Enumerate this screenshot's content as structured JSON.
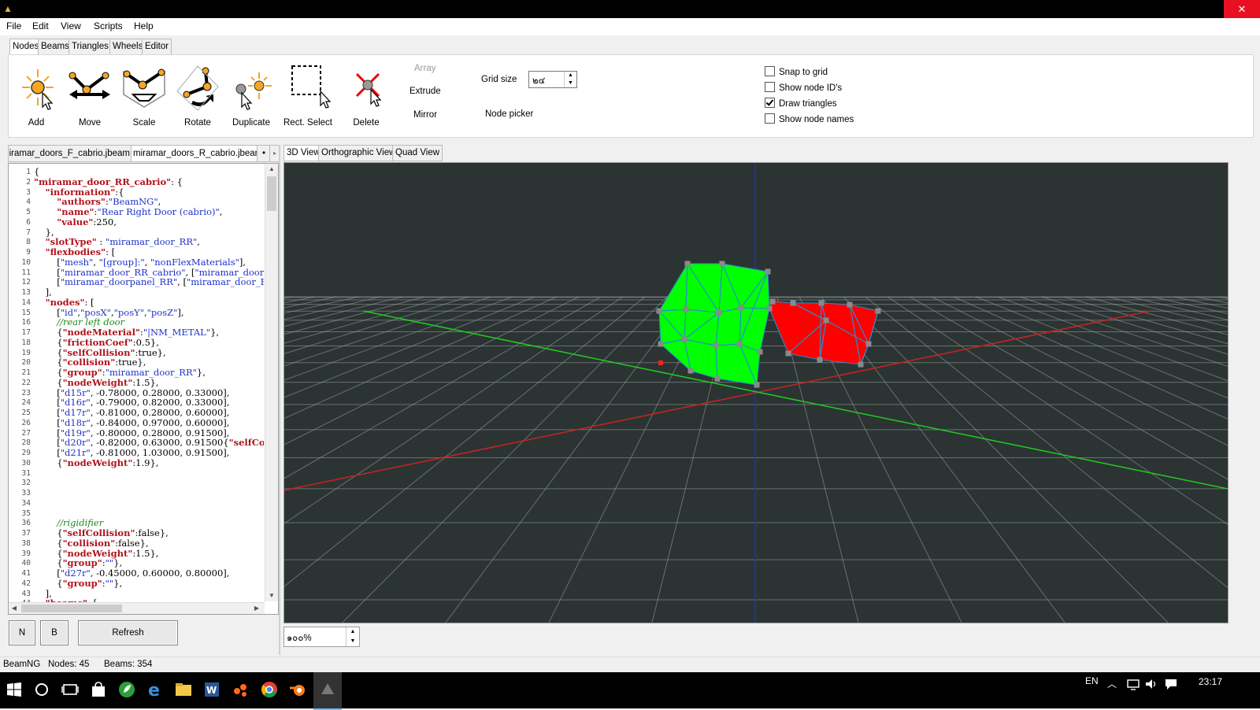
{
  "menu": [
    "File",
    "Edit",
    "View",
    "Scripts",
    "Help"
  ],
  "ribbon": {
    "tabs": [
      "Nodes",
      "Beams",
      "Triangles",
      "Wheels",
      "Editor"
    ],
    "tools": {
      "add": "Add",
      "move": "Move",
      "scale": "Scale",
      "rotate": "Rotate",
      "duplicate": "Duplicate",
      "rect_select": "Rect. Select",
      "delete": "Delete"
    },
    "array": "Array",
    "extrude": "Extrude",
    "mirror": "Mirror",
    "grid_size_label": "Grid size",
    "grid_size_value": "๒๔",
    "node_picker": "Node picker",
    "checkboxes": [
      {
        "label": "Snap to grid",
        "checked": false
      },
      {
        "label": "Show node ID's",
        "checked": false
      },
      {
        "label": "Draw triangles",
        "checked": true
      },
      {
        "label": "Show node names",
        "checked": false
      }
    ]
  },
  "file_tabs": [
    "miramar_doors_F_cabrio.jbeam",
    "miramar_doors_R_cabrio.jbeam"
  ],
  "file_tab_more": "•",
  "file_tab_arrow": "▸",
  "editor": {
    "lines": [
      [
        [
          "p",
          "{"
        ]
      ],
      [
        [
          "k",
          "\"miramar_door_RR_cabrio\""
        ],
        [
          "p",
          ": {"
        ]
      ],
      [
        [
          "p",
          "    "
        ],
        [
          "k",
          "\"information\""
        ],
        [
          "p",
          ":{"
        ]
      ],
      [
        [
          "p",
          "        "
        ],
        [
          "k",
          "\"authors\""
        ],
        [
          "p",
          ":"
        ],
        [
          "s",
          "\"BeamNG\""
        ],
        [
          "p",
          ","
        ]
      ],
      [
        [
          "p",
          "        "
        ],
        [
          "k",
          "\"name\""
        ],
        [
          "p",
          ":"
        ],
        [
          "s",
          "\"Rear Right Door (cabrio)\""
        ],
        [
          "p",
          ","
        ]
      ],
      [
        [
          "p",
          "        "
        ],
        [
          "k",
          "\"value\""
        ],
        [
          "p",
          ":250,"
        ]
      ],
      [
        [
          "p",
          "    },"
        ]
      ],
      [
        [
          "p",
          "    "
        ],
        [
          "k",
          "\"slotType\""
        ],
        [
          "p",
          " : "
        ],
        [
          "s",
          "\"miramar_door_RR\""
        ],
        [
          "p",
          ","
        ]
      ],
      [
        [
          "p",
          "    "
        ],
        [
          "k",
          "\"flexbodies\""
        ],
        [
          "p",
          ": ["
        ]
      ],
      [
        [
          "p",
          "        ["
        ],
        [
          "s",
          "\"mesh\""
        ],
        [
          "p",
          ", "
        ],
        [
          "s",
          "\"[group]:\""
        ],
        [
          "p",
          ", "
        ],
        [
          "s",
          "\"nonFlexMaterials\""
        ],
        [
          "p",
          "],"
        ]
      ],
      [
        [
          "p",
          "        ["
        ],
        [
          "s",
          "\"miramar_door_RR_cabrio\""
        ],
        [
          "p",
          ", ["
        ],
        [
          "s",
          "\"miramar_door"
        ]
      ],
      [
        [
          "p",
          "        ["
        ],
        [
          "s",
          "\"miramar_doorpanel_RR\""
        ],
        [
          "p",
          ", ["
        ],
        [
          "s",
          "\"miramar_door_F"
        ]
      ],
      [
        [
          "p",
          "    ],"
        ]
      ],
      [
        [
          "p",
          "    "
        ],
        [
          "k",
          "\"nodes\""
        ],
        [
          "p",
          ": ["
        ]
      ],
      [
        [
          "p",
          "        ["
        ],
        [
          "s",
          "\"id\""
        ],
        [
          "p",
          ","
        ],
        [
          "s",
          "\"posX\""
        ],
        [
          "p",
          ","
        ],
        [
          "s",
          "\"posY\""
        ],
        [
          "p",
          ","
        ],
        [
          "s",
          "\"posZ\""
        ],
        [
          "p",
          "],"
        ]
      ],
      [
        [
          "p",
          "        "
        ],
        [
          "c",
          "//rear left door"
        ]
      ],
      [
        [
          "p",
          "        {"
        ],
        [
          "k",
          "\"nodeMaterial\""
        ],
        [
          "p",
          ":"
        ],
        [
          "s",
          "\"|NM_METAL\""
        ],
        [
          "p",
          "},"
        ]
      ],
      [
        [
          "p",
          "        {"
        ],
        [
          "k",
          "\"frictionCoef\""
        ],
        [
          "p",
          ":0.5},"
        ]
      ],
      [
        [
          "p",
          "        {"
        ],
        [
          "k",
          "\"selfCollision\""
        ],
        [
          "p",
          ":true},"
        ]
      ],
      [
        [
          "p",
          "        {"
        ],
        [
          "k",
          "\"collision\""
        ],
        [
          "p",
          ":true},"
        ]
      ],
      [
        [
          "p",
          "        {"
        ],
        [
          "k",
          "\"group\""
        ],
        [
          "p",
          ":"
        ],
        [
          "s",
          "\"miramar_door_RR\""
        ],
        [
          "p",
          "},"
        ]
      ],
      [
        [
          "p",
          "        {"
        ],
        [
          "k",
          "\"nodeWeight\""
        ],
        [
          "p",
          ":1.5},"
        ]
      ],
      [
        [
          "p",
          "        ["
        ],
        [
          "s",
          "\"d15r\""
        ],
        [
          "p",
          ", -0.78000, 0.28000, 0.33000],"
        ]
      ],
      [
        [
          "p",
          "        ["
        ],
        [
          "s",
          "\"d16r\""
        ],
        [
          "p",
          ", -0.79000, 0.82000, 0.33000],"
        ]
      ],
      [
        [
          "p",
          "        ["
        ],
        [
          "s",
          "\"d17r\""
        ],
        [
          "p",
          ", -0.81000, 0.28000, 0.60000],"
        ]
      ],
      [
        [
          "p",
          "        ["
        ],
        [
          "s",
          "\"d18r\""
        ],
        [
          "p",
          ", -0.84000, 0.97000, 0.60000],"
        ]
      ],
      [
        [
          "p",
          "        ["
        ],
        [
          "s",
          "\"d19r\""
        ],
        [
          "p",
          ", -0.80000, 0.28000, 0.91500],"
        ]
      ],
      [
        [
          "p",
          "        ["
        ],
        [
          "s",
          "\"d20r\""
        ],
        [
          "p",
          ", -0.82000, 0.63000, 0.91500{"
        ],
        [
          "k",
          "\"selfCo"
        ]
      ],
      [
        [
          "p",
          "        ["
        ],
        [
          "s",
          "\"d21r\""
        ],
        [
          "p",
          ", -0.81000, 1.03000, 0.91500],"
        ]
      ],
      [
        [
          "p",
          "        {"
        ],
        [
          "k",
          "\"nodeWeight\""
        ],
        [
          "p",
          ":1.9},"
        ]
      ],
      [],
      [],
      [],
      [],
      [],
      [
        [
          "p",
          "        "
        ],
        [
          "c",
          "//rigidifier"
        ]
      ],
      [
        [
          "p",
          "        {"
        ],
        [
          "k",
          "\"selfCollision\""
        ],
        [
          "p",
          ":false},"
        ]
      ],
      [
        [
          "p",
          "        {"
        ],
        [
          "k",
          "\"collision\""
        ],
        [
          "p",
          ":false},"
        ]
      ],
      [
        [
          "p",
          "        {"
        ],
        [
          "k",
          "\"nodeWeight\""
        ],
        [
          "p",
          ":1.5},"
        ]
      ],
      [
        [
          "p",
          "        {"
        ],
        [
          "k",
          "\"group\""
        ],
        [
          "p",
          ":"
        ],
        [
          "s",
          "\"\""
        ],
        [
          "p",
          "},"
        ]
      ],
      [
        [
          "p",
          "        ["
        ],
        [
          "s",
          "\"d27r\""
        ],
        [
          "p",
          ", -0.45000, 0.60000, 0.80000],"
        ]
      ],
      [
        [
          "p",
          "        {"
        ],
        [
          "k",
          "\"group\""
        ],
        [
          "p",
          ":"
        ],
        [
          "s",
          "\"\""
        ],
        [
          "p",
          "},"
        ]
      ],
      [
        [
          "p",
          "    ],"
        ]
      ],
      [
        [
          "p",
          "    "
        ],
        [
          "k",
          "\"beams\""
        ],
        [
          "p",
          ": ["
        ]
      ]
    ]
  },
  "buttons": {
    "n": "N",
    "b": "B",
    "refresh": "Refresh"
  },
  "view_tabs": [
    "3D View",
    "Orthographic View",
    "Quad View"
  ],
  "zoom_value": "๑๐๐%",
  "status": {
    "app": "BeamNG",
    "nodes": "Nodes: 45",
    "beams": "Beams: 354"
  },
  "taskbar": {
    "lang": "EN",
    "time": "23:17"
  },
  "colors": {
    "door_front": "#00ff00",
    "door_rear": "#ff0000",
    "wire": "#2a8cd0",
    "grid": "#9aa3a2",
    "viewport_bg": "#2b3433"
  }
}
